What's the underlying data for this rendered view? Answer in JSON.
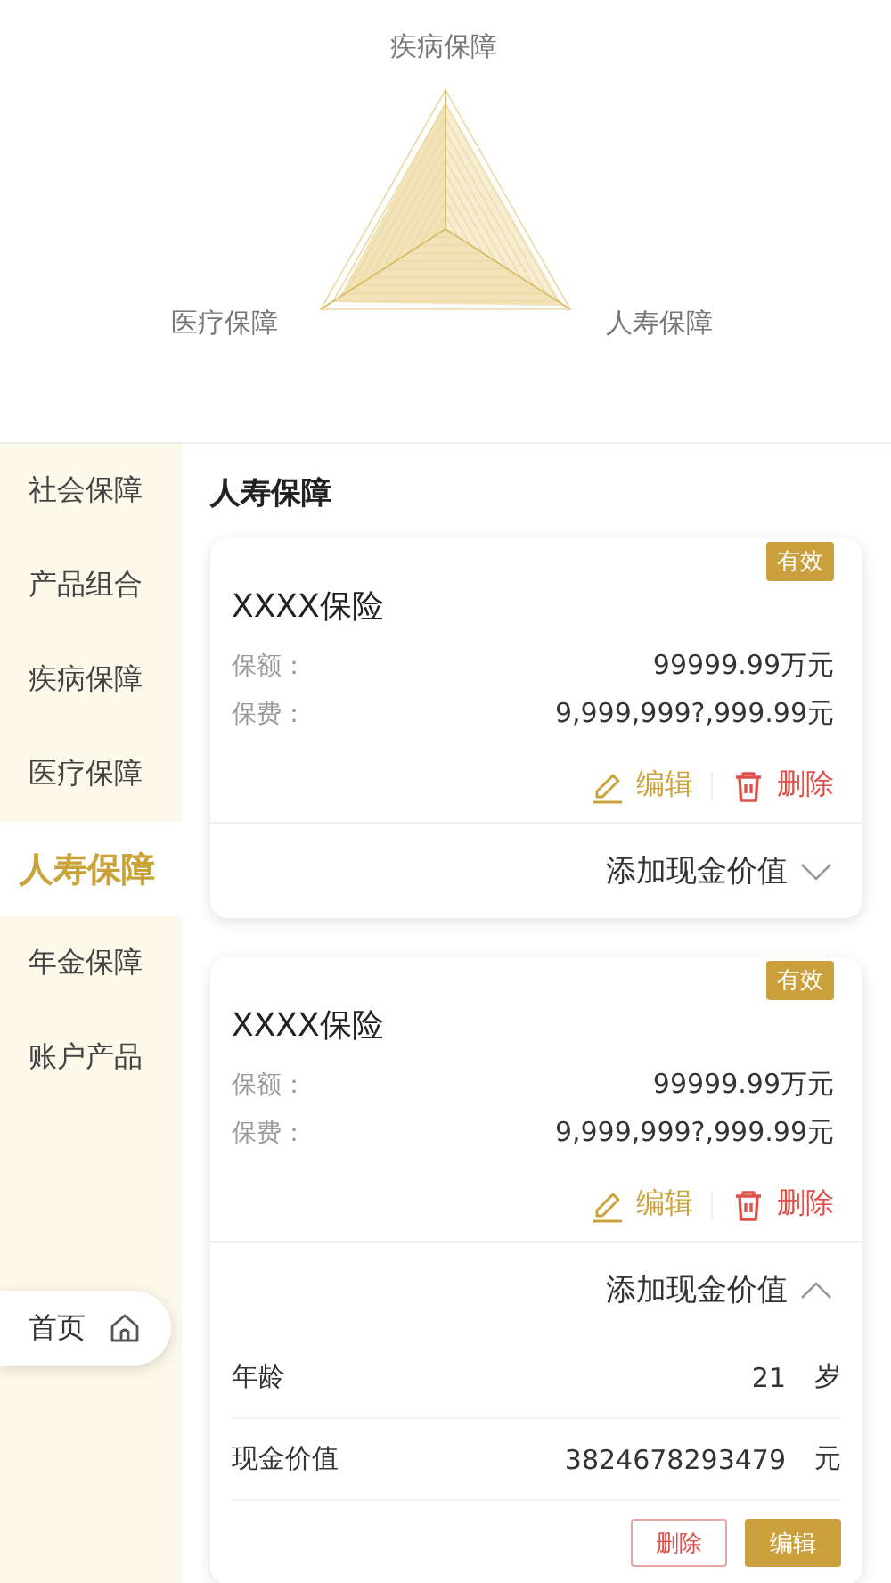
{
  "radar": {
    "axes": [
      {
        "label": "疾病保障"
      },
      {
        "label": "医疗保障"
      },
      {
        "label": "人寿保障"
      }
    ]
  },
  "sidebar": {
    "items": [
      {
        "label": "社会保障",
        "selected": false
      },
      {
        "label": "产品组合",
        "selected": false
      },
      {
        "label": "疾病保障",
        "selected": false
      },
      {
        "label": "医疗保障",
        "selected": false
      },
      {
        "label": "人寿保障",
        "selected": true
      },
      {
        "label": "年金保障",
        "selected": false
      },
      {
        "label": "账户产品",
        "selected": false
      }
    ]
  },
  "home_button": {
    "label": "首页"
  },
  "section_title": "人寿保障",
  "policies": [
    {
      "status": "有效",
      "name": "XXXX保险",
      "fields": [
        {
          "label": "保额：",
          "value": "99999.99万元"
        },
        {
          "label": "保费：",
          "value": "9,999,999?,999.99元"
        }
      ],
      "edit": "编辑",
      "delete": "删除",
      "add_cash_value": "添加现金价值",
      "expanded": false
    },
    {
      "status": "有效",
      "name": "XXXX保险",
      "fields": [
        {
          "label": "保额：",
          "value": "99999.99万元"
        },
        {
          "label": "保费：",
          "value": "9,999,999?,999.99元"
        }
      ],
      "edit": "编辑",
      "delete": "删除",
      "add_cash_value": "添加现金价值",
      "expanded": true,
      "cash_rows": [
        {
          "label": "年龄",
          "value": "21",
          "unit": "岁"
        },
        {
          "label": "现金价值",
          "value": "3824678293479",
          "unit": "元"
        }
      ],
      "row_buttons": {
        "delete": "删除",
        "edit": "编辑"
      }
    }
  ]
}
